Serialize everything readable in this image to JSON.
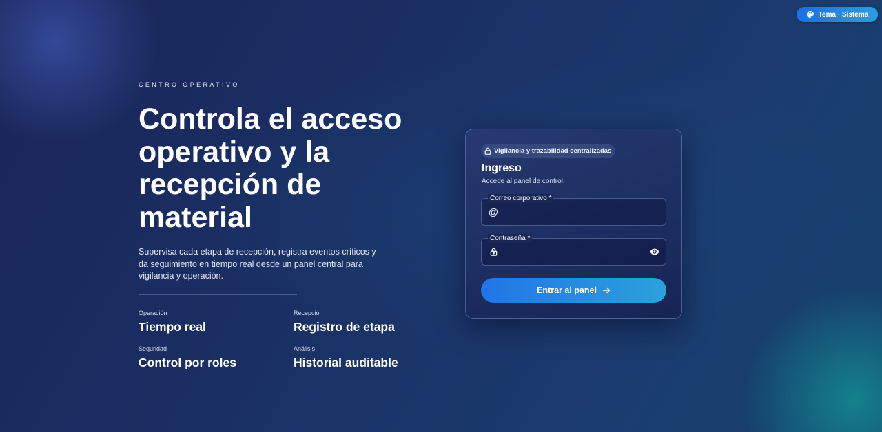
{
  "theme_button": {
    "label": "Tema · Sistema",
    "icon": "palette-icon"
  },
  "hero": {
    "eyebrow": "CENTRO OPERATIVO",
    "headline": "Controla el acceso operativo y la recepción de material",
    "description": "Supervisa cada etapa de recepción, registra eventos críticos y da seguimiento en tiempo real desde un panel central para vigilancia y operación."
  },
  "stats": [
    {
      "label": "Operación",
      "value": "Tiempo real"
    },
    {
      "label": "Recepción",
      "value": "Registro de etapa"
    },
    {
      "label": "Seguridad",
      "value": "Control por roles"
    },
    {
      "label": "Análisis",
      "value": "Historial auditable"
    }
  ],
  "login": {
    "badge": "Vigilancia y trazabilidad centralizadas",
    "title": "Ingreso",
    "subtitle": "Accede al panel de control.",
    "email_label": "Correo corporativo *",
    "email_value": "",
    "password_label": "Contraseña *",
    "password_value": "",
    "submit_label": "Entrar al panel"
  },
  "colors": {
    "accent_start": "#2175e6",
    "accent_end": "#2aa2dc",
    "background": "#1a2e63"
  }
}
